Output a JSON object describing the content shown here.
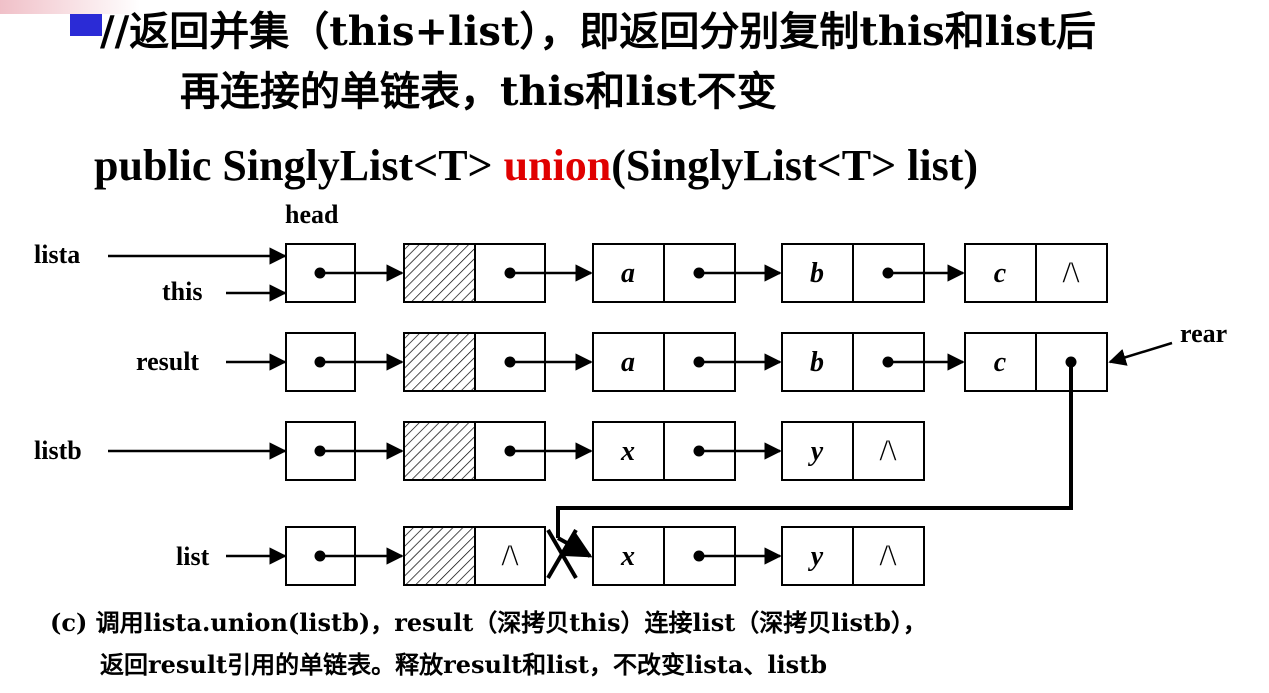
{
  "title": {
    "line1": "//返回并集（this+list），即返回分别复制this和list后",
    "line2": "再连接的单链表，this和list不变"
  },
  "signature": {
    "before": "public SinglyList<T> ",
    "keyword": "union",
    "after": "(SinglyList<T> list)",
    "keyword_color": "#e00000"
  },
  "diagram": {
    "labels": {
      "head": "head",
      "lista": "lista",
      "this": "this",
      "result": "result",
      "listb": "listb",
      "list": "list",
      "rear": "rear"
    },
    "rows": {
      "lista": [
        "a",
        "b",
        "c"
      ],
      "result": [
        "a",
        "b",
        "c"
      ],
      "listb": [
        "x",
        "y"
      ],
      "list": [
        "x",
        "y"
      ]
    },
    "null_symbol": "/\\"
  },
  "caption": {
    "line1": "(c) 调用lista.union(listb)，result（深拷贝this）连接list（深拷贝listb），",
    "line2": "返回result引用的单链表。释放result和list，不改变lista、listb"
  }
}
